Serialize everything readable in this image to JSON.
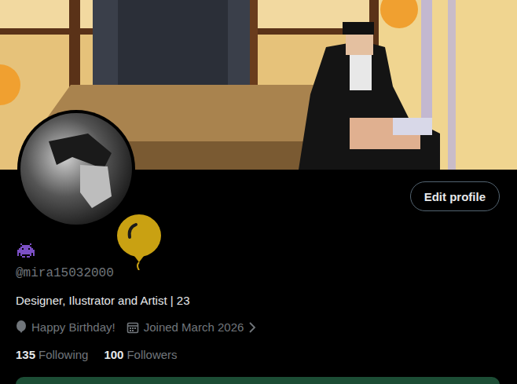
{
  "profile": {
    "handle": "@mira15032000",
    "bio": "Designer, Ilustrator and Artist | 23",
    "birthday": "Happy Birthday!",
    "joined": "Joined March 2026"
  },
  "stats": [
    {
      "count": "135",
      "label": "Following"
    },
    {
      "count": "100",
      "label": "Followers"
    }
  ],
  "buttons": [
    "Edit profile"
  ]
}
